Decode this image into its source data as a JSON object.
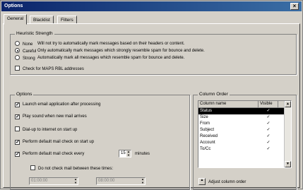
{
  "window": {
    "title": "Options",
    "close_glyph": "×"
  },
  "tabs": [
    {
      "label": "General"
    },
    {
      "label": "Blacklist"
    },
    {
      "label": "Filters"
    }
  ],
  "heuristic": {
    "title": "Heuristic Strength",
    "options": [
      {
        "label": "None",
        "desc": "Will not try to automatically mark messages based on their headers or content.",
        "selected": false
      },
      {
        "label": "Careful",
        "desc": "Only automatically mark messages which strongly resemble spam for bounce and delete.",
        "selected": true
      },
      {
        "label": "Strong",
        "desc": "Automatically mark all messages which resemble spam for bounce and delete.",
        "selected": false
      }
    ],
    "check_maps": {
      "label": "Check for MAPS RBL addresses",
      "checked": false
    }
  },
  "options": {
    "title": "Options",
    "items": [
      {
        "label": "Launch email application after processing",
        "checked": true
      },
      {
        "label": "Play sound when new mail arrives",
        "checked": true
      },
      {
        "label": "Dial-up to internet on start up",
        "checked": false
      },
      {
        "label": "Perform default mail check on start up",
        "checked": true
      },
      {
        "label": "Perform default mail check every",
        "checked": true
      }
    ],
    "interval_value": "15",
    "interval_unit": "minutes",
    "no_check_label": "Do not check mail between these times:",
    "no_check_checked": false,
    "time_from": "01:00:00",
    "time_to": "08:00:00"
  },
  "columns": {
    "title": "Column Order",
    "header_name": "Column name",
    "header_visible": "Visible",
    "rows": [
      {
        "name": "Status",
        "visible": true,
        "selected": true
      },
      {
        "name": "Size",
        "visible": true,
        "selected": false
      },
      {
        "name": "From",
        "visible": true,
        "selected": false
      },
      {
        "name": "Subject",
        "visible": true,
        "selected": false
      },
      {
        "name": "Received",
        "visible": true,
        "selected": false
      },
      {
        "name": "Account",
        "visible": true,
        "selected": false
      },
      {
        "name": "To/Cc",
        "visible": true,
        "selected": false
      }
    ],
    "adjust_label": "Adjust column order"
  },
  "glyphs": {
    "check": "✓",
    "up": "▲",
    "down": "▼"
  }
}
